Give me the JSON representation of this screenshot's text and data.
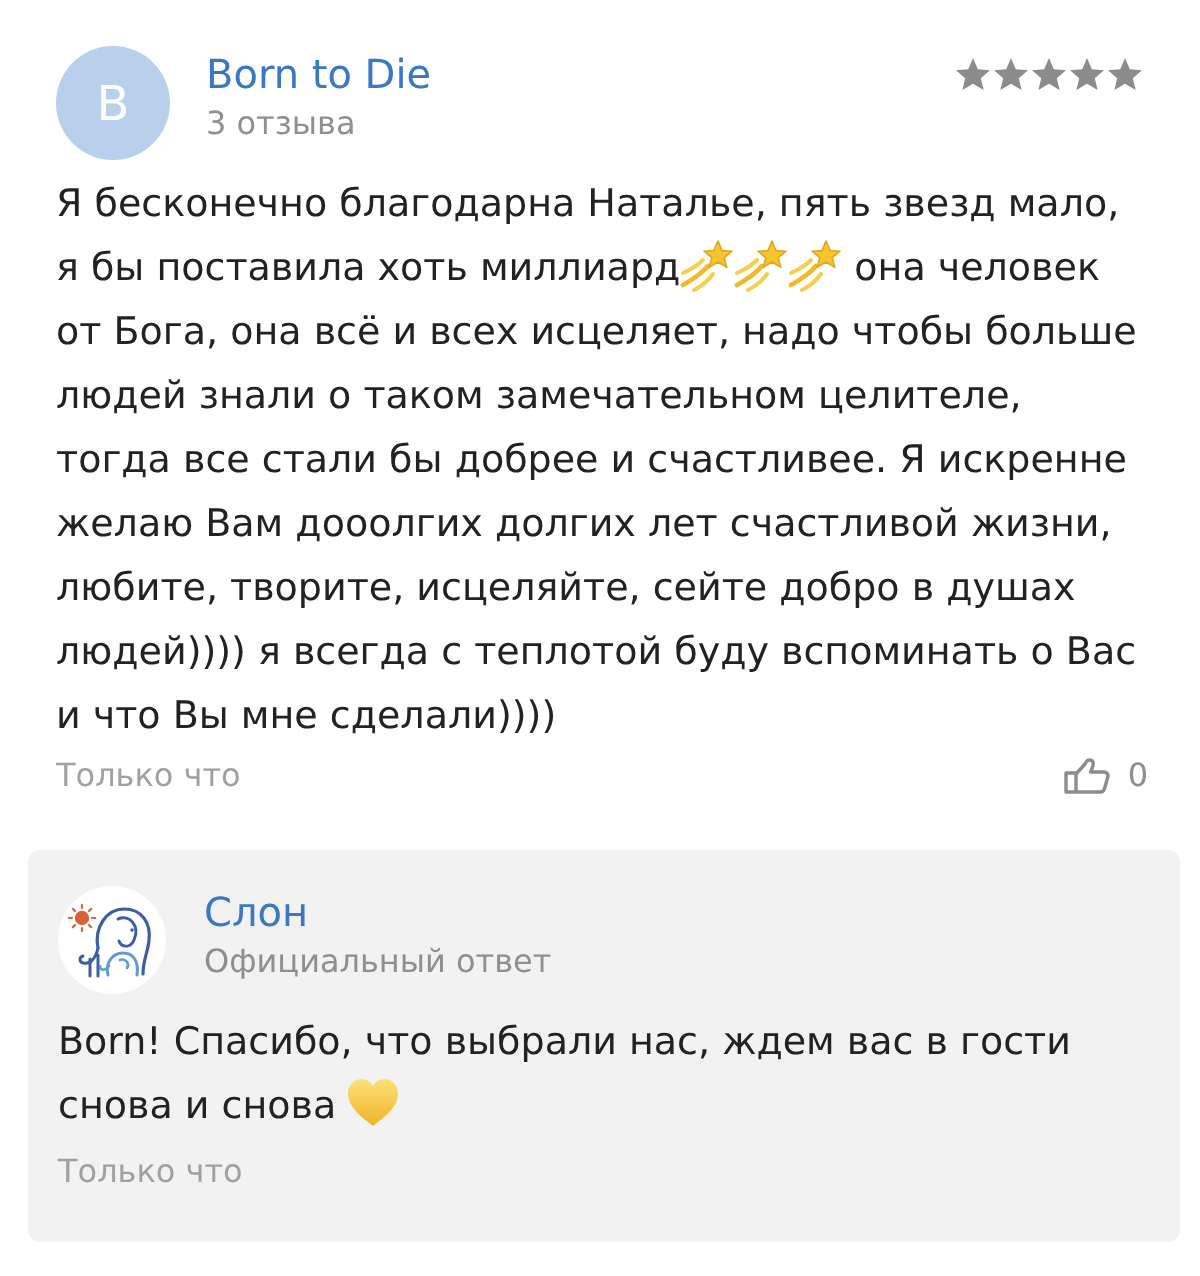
{
  "review": {
    "author": {
      "initial": "B",
      "name": "Born to Die",
      "reviews_count": "3 отзыва"
    },
    "stars": 5,
    "body": [
      [
        {
          "kind": "text",
          "text": "Я бесконечно благодарна Наталье, пять звезд мало,"
        }
      ],
      [
        {
          "kind": "text",
          "text": "я бы поставила хоть миллиард"
        },
        {
          "kind": "dizzy"
        },
        {
          "kind": "dizzy"
        },
        {
          "kind": "dizzy"
        },
        {
          "kind": "text",
          "text": "она человек"
        }
      ],
      [
        {
          "kind": "text",
          "text": "от Бога, она всё и всех исцеляет, надо чтобы больше людей знали о таком замечательном целителе, тогда все стали бы добрее и счастливее. Я искренне желаю Вам дооолгих долгих лет счастливой жизни, любите, творите, исцеляйте, сейте добро в душах людей)))) я всегда с теплотой буду вспоминать о Вас и что Вы мне сделали))))"
        }
      ]
    ],
    "time": "Только что",
    "likes": "0"
  },
  "reply": {
    "author": {
      "name": "Слон",
      "role": "Официальный ответ"
    },
    "body": [
      [
        {
          "kind": "text",
          "text": "Born! Спасибо, что выбрали нас, ждем вас в гости"
        }
      ],
      [
        {
          "kind": "text",
          "text": "снова и снова"
        },
        {
          "kind": "heart"
        }
      ]
    ],
    "time": "Только что"
  }
}
